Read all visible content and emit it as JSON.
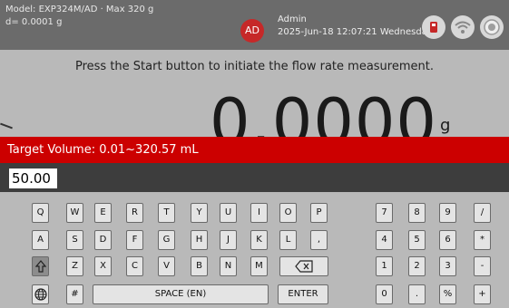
{
  "status": {
    "model": "Model: EXP324M/AD · Max 320 g",
    "readability": "d= 0.0001 g",
    "avatar_initials": "AD",
    "user_name": "Admin",
    "datetime": "2025-Jun-18 12:07:21 Wednesday",
    "icons": [
      "usb-drive-icon",
      "wifi-icon",
      "level-bubble-icon"
    ]
  },
  "main": {
    "instruction": "Press the Start button to initiate the flow rate measurement.",
    "weight_value": "0.0000",
    "weight_unit": "g"
  },
  "target": {
    "label": "Target Volume: 0.01~320.57 mL"
  },
  "input": {
    "value": "50.00"
  },
  "keyboard": {
    "row1": [
      "Q",
      "W",
      "E",
      "R",
      "T",
      "Y",
      "U",
      "I",
      "O",
      "P"
    ],
    "row2": [
      "A",
      "S",
      "D",
      "F",
      "G",
      "H",
      "J",
      "K",
      "L",
      ","
    ],
    "row3": [
      "Z",
      "X",
      "C",
      "V",
      "B",
      "N",
      "M"
    ],
    "space_label": "SPACE (EN)",
    "enter_label": "ENTER",
    "hash_label": "#",
    "num1": [
      "7",
      "8",
      "9",
      "/"
    ],
    "num2": [
      "4",
      "5",
      "6",
      "*"
    ],
    "num3": [
      "1",
      "2",
      "3",
      "-"
    ],
    "num4": [
      "0",
      ".",
      "%",
      "+"
    ]
  },
  "colors": {
    "target_bar": "#cc0000",
    "avatar": "#c62828",
    "status_bar": "#6b6b6b"
  }
}
